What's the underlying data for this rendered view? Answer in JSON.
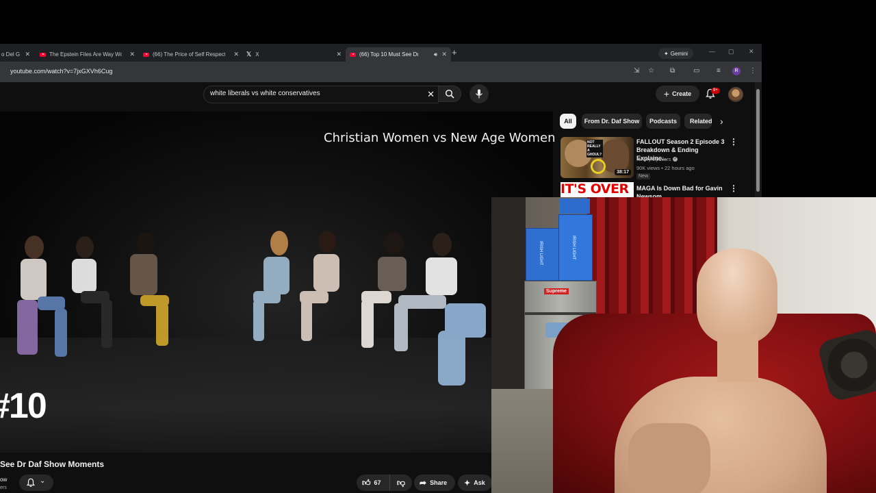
{
  "browser": {
    "tabs": [
      {
        "title": "o Del G",
        "icon": "unknown-icon",
        "active": false
      },
      {
        "title": "The Epstein Files Are Way Wors",
        "icon": "youtube-icon",
        "active": false
      },
      {
        "title": "(66) The Price of Self Respect -",
        "icon": "youtube-icon",
        "active": false
      },
      {
        "title": "X",
        "icon": "x-icon",
        "active": false
      },
      {
        "title": "(66) Top 10 Must See Dr Da",
        "icon": "youtube-icon",
        "active": true,
        "audio": true
      }
    ],
    "new_tab": "+",
    "gemini_label": "Gemini",
    "url": "youtube.com/watch?v=7jxGXVh6Cug",
    "profile_initial": "R"
  },
  "youtube": {
    "search": {
      "value": "white liberals vs white conservatives",
      "clear": "✕"
    },
    "create_label": "Create",
    "notification_count": "9+",
    "video": {
      "overlay_title": "Christian Women vs New Age Women",
      "overlay_rank": "#10",
      "title": "See Dr Daf Show Moments",
      "channel_fragment": "ow",
      "subs_fragment": "ers",
      "likes": "67",
      "share_label": "Share",
      "ask_label": "Ask"
    },
    "chips": [
      "All",
      "From Dr. Daf Show",
      "Podcasts",
      "Related"
    ],
    "recommendations": [
      {
        "title": "FALLOUT Season 2 Episode 3 Breakdown & Ending Explaine...",
        "channel": "Heavy Spoilers",
        "verified": true,
        "meta": "90K views • 22 hours ago",
        "badge": "New",
        "duration": "38:17",
        "thumb_text": "NOT REALLY A GHOUL?"
      },
      {
        "title": "MAGA Is Down Bad for Gavin Newsom",
        "thumb_text": "IT'S OVER"
      }
    ]
  },
  "webcam": {
    "box_label_1": "IRISH LIGHT",
    "box_label_2": "IRISH LIGHT",
    "box_label_3": "IRISH LIGHT",
    "sticker_text": "Supreme"
  }
}
